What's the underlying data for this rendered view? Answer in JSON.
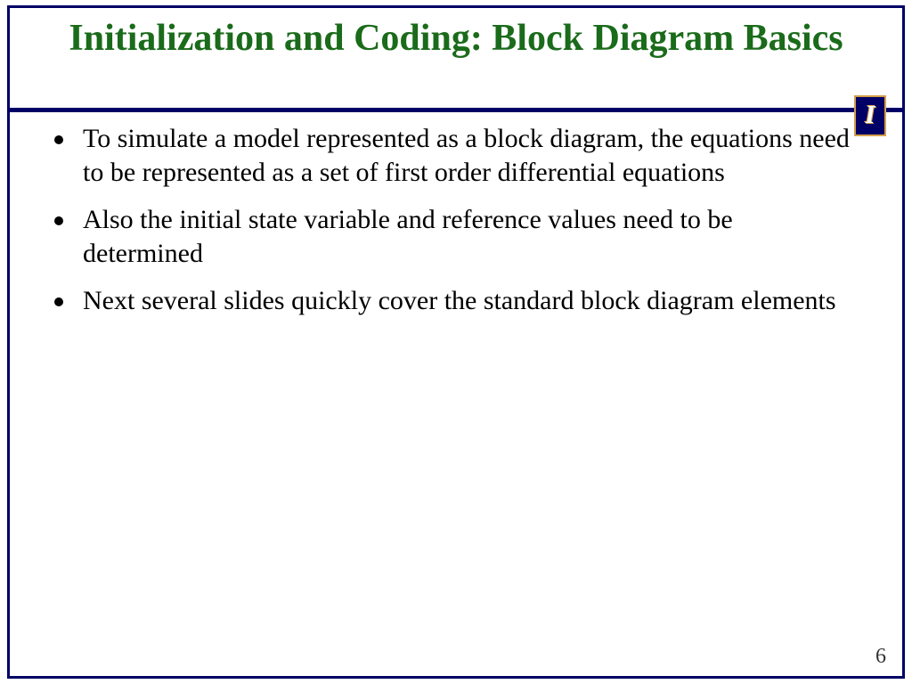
{
  "title": "Initialization and Coding: Block Diagram Basics",
  "logo_letter": "I",
  "bullets": [
    "To simulate a model represented as a block diagram, the equations need to be represented as a set of first order differential equations",
    "Also the initial state variable and reference values need to be determined",
    "Next several slides quickly cover the standard block diagram elements"
  ],
  "page_number": "6"
}
